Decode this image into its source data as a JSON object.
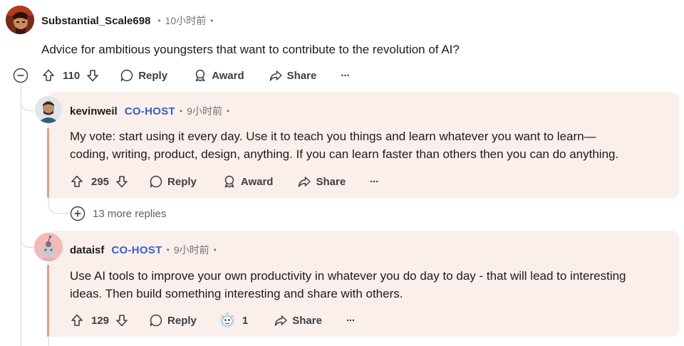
{
  "top_comment": {
    "username": "Substantial_Scale698",
    "time": "10小时前",
    "body": "Advice for ambitious youngsters that want to contribute to the revolution of AI?",
    "votes": "110",
    "reply_label": "Reply",
    "award_label": "Award",
    "share_label": "Share",
    "more_label": "···"
  },
  "reply1": {
    "username": "kevinweil",
    "badge": "CO-HOST",
    "time": "9小时前",
    "body_line1": "My vote: start using it every day. Use it to teach you things and learn whatever you want to learn—",
    "body_line2": "coding, writing, product, design, anything. If you can learn faster than others then you can do anything.",
    "votes": "295",
    "reply_label": "Reply",
    "award_label": "Award",
    "share_label": "Share",
    "more_label": "···",
    "more_replies": "13 more replies"
  },
  "reply2": {
    "username": "dataisf",
    "badge": "CO-HOST",
    "time": "9小时前",
    "body_line1": "Use AI tools to improve your own productivity in whatever you do day to day - that will lead to interesting",
    "body_line2": "ideas. Then build something interesting and share with others.",
    "votes": "129",
    "reply_label": "Reply",
    "award_count": "1",
    "share_label": "Share",
    "more_label": "···"
  },
  "colors": {
    "cohost": "#3461c9",
    "card_bg": "#fbefec",
    "card_accent": "#ef9a7f",
    "thread_line": "#d6d8da"
  },
  "icons": [
    "collapse-icon",
    "upvote-icon",
    "downvote-icon",
    "reply-icon",
    "award-icon",
    "share-icon",
    "more-icon",
    "expand-icon",
    "award-badge-icon"
  ]
}
